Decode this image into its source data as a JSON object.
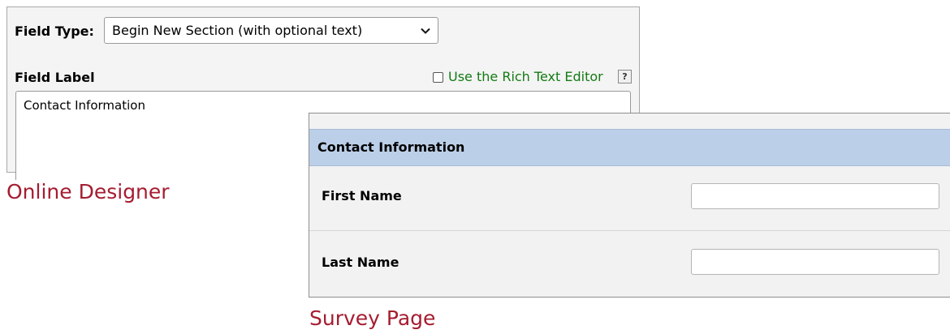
{
  "designer": {
    "field_type_label": "Field Type:",
    "field_type_value": "Begin New Section (with optional text)",
    "field_label_heading": "Field Label",
    "rich_text_label": "Use the Rich Text Editor",
    "help_label": "?",
    "field_label_value": "Contact Information",
    "caption": "Online Designer"
  },
  "survey": {
    "section_title": "Contact Information",
    "fields": [
      {
        "label": "First Name",
        "value": ""
      },
      {
        "label": "Last Name",
        "value": ""
      }
    ],
    "caption": "Survey Page"
  },
  "colors": {
    "caption": "#a51c30",
    "rich_text_label": "#137b13",
    "section_header_bg": "#bccfe8",
    "panel_bg": "#f2f2f2"
  },
  "icons": {
    "select_chevron": "chevron-down-icon",
    "help": "help-icon"
  }
}
